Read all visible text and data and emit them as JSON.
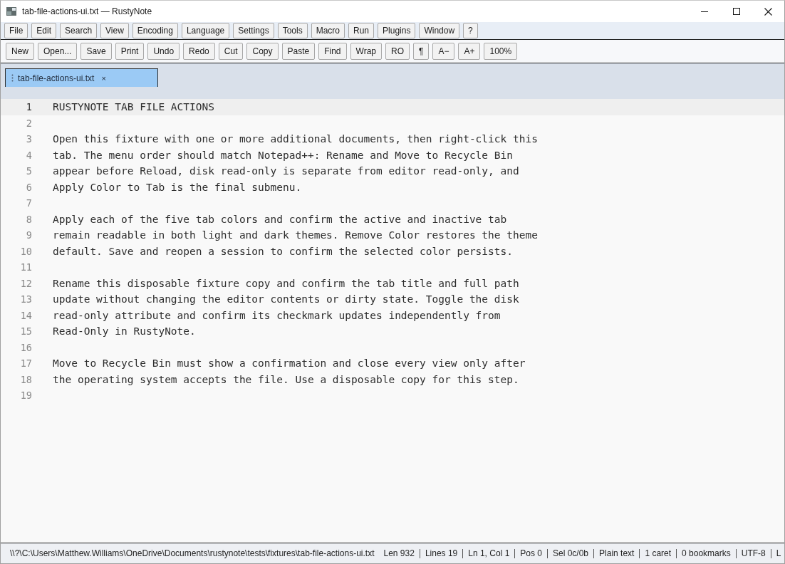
{
  "window": {
    "title": "tab-file-actions-ui.txt — RustyNote"
  },
  "menu": [
    "File",
    "Edit",
    "Search",
    "View",
    "Encoding",
    "Language",
    "Settings",
    "Tools",
    "Macro",
    "Run",
    "Plugins",
    "Window",
    "?"
  ],
  "toolbar": [
    "New",
    "Open...",
    "Save",
    "Print",
    "Undo",
    "Redo",
    "Cut",
    "Copy",
    "Paste",
    "Find",
    "Wrap",
    "RO",
    "¶",
    "A−",
    "A+",
    "100%"
  ],
  "tabs": [
    {
      "label": "tab-file-actions-ui.txt",
      "close": "×",
      "selected": true
    }
  ],
  "editor": {
    "lines": [
      {
        "number": "1",
        "text": "RUSTYNOTE TAB FILE ACTIONS",
        "current": true
      },
      {
        "number": "2",
        "current": false
      },
      {
        "number": "3",
        "text": "Open this fixture with one or more additional documents, then right-click this",
        "current": false
      },
      {
        "number": "4",
        "text": "tab. The menu order should match Notepad++: Rename and Move to Recycle Bin",
        "current": false
      },
      {
        "number": "5",
        "text": "appear before Reload, disk read-only is separate from editor read-only, and",
        "current": false
      },
      {
        "number": "6",
        "text": "Apply Color to Tab is the final submenu.",
        "current": false
      },
      {
        "number": "7",
        "current": false
      },
      {
        "number": "8",
        "text": "Apply each of the five tab colors and confirm the active and inactive tab",
        "current": false
      },
      {
        "number": "9",
        "text": "remain readable in both light and dark themes. Remove Color restores the theme",
        "current": false
      },
      {
        "number": "10",
        "text": "default. Save and reopen a session to confirm the selected color persists.",
        "current": false
      },
      {
        "number": "11",
        "current": false
      },
      {
        "number": "12",
        "text": "Rename this disposable fixture copy and confirm the tab title and full path",
        "current": false
      },
      {
        "number": "13",
        "text": "update without changing the editor contents or dirty state. Toggle the disk",
        "current": false
      },
      {
        "number": "14",
        "text": "read-only attribute and confirm its checkmark updates independently from",
        "current": false
      },
      {
        "number": "15",
        "text": "Read-Only in RustyNote.",
        "current": false
      },
      {
        "number": "16",
        "current": false
      },
      {
        "number": "17",
        "text": "Move to Recycle Bin must show a confirmation and close every view only after",
        "current": false
      },
      {
        "number": "18",
        "text": "the operating system accepts the file. Use a disposable copy for this step.",
        "current": false
      },
      {
        "number": "19",
        "current": false
      }
    ]
  },
  "status_bar": {
    "path": "\\\\?\\C:\\Users\\Matthew.Williams\\OneDrive\\Documents\\rustynote\\tests\\fixtures\\tab-file-actions-ui.txt",
    "items": [
      "Len 932",
      "Lines 19",
      "Ln 1, Col 1",
      "Pos 0",
      "Sel 0c/0b",
      "Plain text",
      "1 caret",
      "0 bookmarks",
      "UTF-8",
      "L"
    ]
  }
}
